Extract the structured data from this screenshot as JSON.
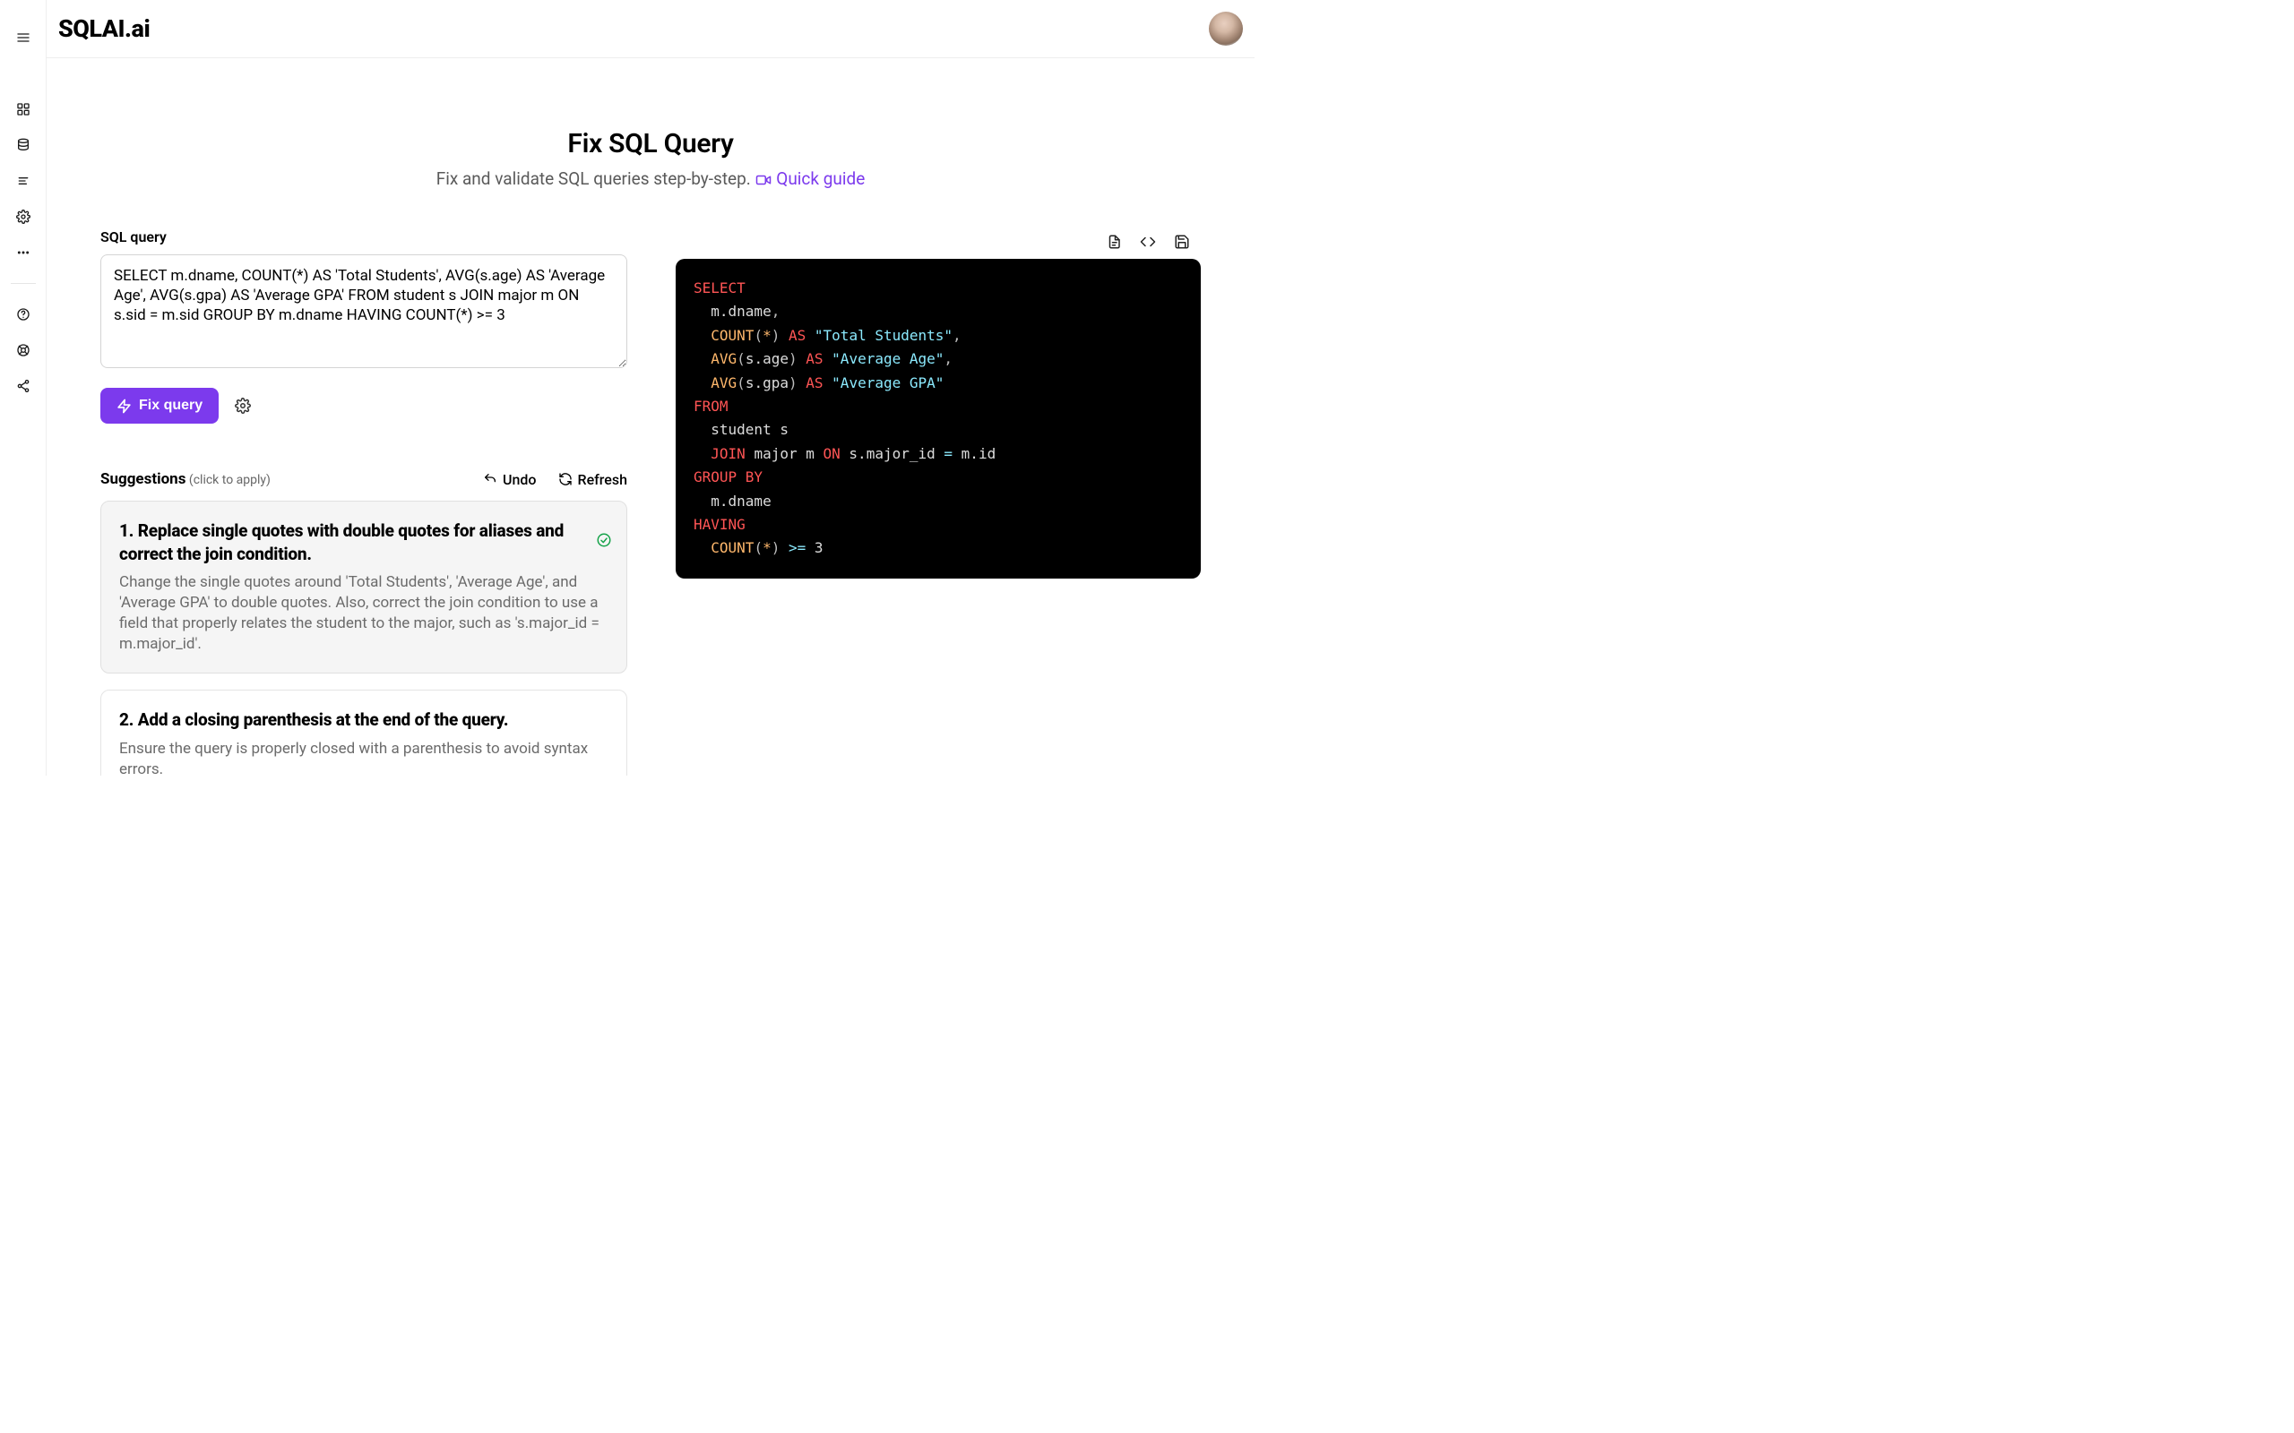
{
  "brand": "SQLAI.ai",
  "page": {
    "title": "Fix SQL Query",
    "subtitle": "Fix and validate SQL queries step-by-step.",
    "quick_guide": "Quick guide"
  },
  "input": {
    "label": "SQL query",
    "value": "SELECT m.dname, COUNT(*) AS 'Total Students', AVG(s.age) AS 'Average Age', AVG(s.gpa) AS 'Average GPA' FROM student s JOIN major m ON s.sid = m.sid GROUP BY m.dname HAVING COUNT(*) >= 3"
  },
  "actions": {
    "fix": "Fix query"
  },
  "suggestions": {
    "title": "Suggestions",
    "note": "(click to apply)",
    "undo": "Undo",
    "refresh": "Refresh",
    "items": [
      {
        "title": "1. Replace single quotes with double quotes for aliases and correct the join condition.",
        "body": "Change the single quotes around 'Total Students', 'Average Age', and 'Average GPA' to double quotes. Also, correct the join condition to use a field that properly relates the student to the major, such as 's.major_id = m.major_id'.",
        "applied": true
      },
      {
        "title": "2. Add a closing parenthesis at the end of the query.",
        "body": "Ensure the query is properly closed with a parenthesis to avoid syntax errors.",
        "applied": false
      }
    ]
  },
  "output": {
    "tokens": [
      {
        "t": "kw",
        "v": "SELECT"
      },
      {
        "t": "nl"
      },
      {
        "t": "sp",
        "v": "  "
      },
      {
        "t": "id",
        "v": "m.dname"
      },
      {
        "t": "punc",
        "v": ","
      },
      {
        "t": "nl"
      },
      {
        "t": "sp",
        "v": "  "
      },
      {
        "t": "func",
        "v": "COUNT"
      },
      {
        "t": "punc",
        "v": "("
      },
      {
        "t": "star",
        "v": "*"
      },
      {
        "t": "punc",
        "v": ")"
      },
      {
        "t": "sp",
        "v": " "
      },
      {
        "t": "alias-kw",
        "v": "AS"
      },
      {
        "t": "sp",
        "v": " "
      },
      {
        "t": "str",
        "v": "\"Total Students\""
      },
      {
        "t": "punc",
        "v": ","
      },
      {
        "t": "nl"
      },
      {
        "t": "sp",
        "v": "  "
      },
      {
        "t": "func",
        "v": "AVG"
      },
      {
        "t": "punc",
        "v": "("
      },
      {
        "t": "id",
        "v": "s.age"
      },
      {
        "t": "punc",
        "v": ")"
      },
      {
        "t": "sp",
        "v": " "
      },
      {
        "t": "alias-kw",
        "v": "AS"
      },
      {
        "t": "sp",
        "v": " "
      },
      {
        "t": "str",
        "v": "\"Average Age\""
      },
      {
        "t": "punc",
        "v": ","
      },
      {
        "t": "nl"
      },
      {
        "t": "sp",
        "v": "  "
      },
      {
        "t": "func",
        "v": "AVG"
      },
      {
        "t": "punc",
        "v": "("
      },
      {
        "t": "id",
        "v": "s.gpa"
      },
      {
        "t": "punc",
        "v": ")"
      },
      {
        "t": "sp",
        "v": " "
      },
      {
        "t": "alias-kw",
        "v": "AS"
      },
      {
        "t": "sp",
        "v": " "
      },
      {
        "t": "str",
        "v": "\"Average GPA\""
      },
      {
        "t": "nl"
      },
      {
        "t": "kw",
        "v": "FROM"
      },
      {
        "t": "nl"
      },
      {
        "t": "sp",
        "v": "  "
      },
      {
        "t": "id",
        "v": "student s"
      },
      {
        "t": "nl"
      },
      {
        "t": "sp",
        "v": "  "
      },
      {
        "t": "kw",
        "v": "JOIN"
      },
      {
        "t": "sp",
        "v": " "
      },
      {
        "t": "id",
        "v": "major m"
      },
      {
        "t": "sp",
        "v": " "
      },
      {
        "t": "kw",
        "v": "ON"
      },
      {
        "t": "sp",
        "v": " "
      },
      {
        "t": "id",
        "v": "s.major_id"
      },
      {
        "t": "sp",
        "v": " "
      },
      {
        "t": "op",
        "v": "="
      },
      {
        "t": "sp",
        "v": " "
      },
      {
        "t": "id",
        "v": "m.id"
      },
      {
        "t": "nl"
      },
      {
        "t": "kw",
        "v": "GROUP BY"
      },
      {
        "t": "nl"
      },
      {
        "t": "sp",
        "v": "  "
      },
      {
        "t": "id",
        "v": "m.dname"
      },
      {
        "t": "nl"
      },
      {
        "t": "kw",
        "v": "HAVING"
      },
      {
        "t": "nl"
      },
      {
        "t": "sp",
        "v": "  "
      },
      {
        "t": "func",
        "v": "COUNT"
      },
      {
        "t": "punc",
        "v": "("
      },
      {
        "t": "star",
        "v": "*"
      },
      {
        "t": "punc",
        "v": ")"
      },
      {
        "t": "sp",
        "v": " "
      },
      {
        "t": "op",
        "v": ">="
      },
      {
        "t": "sp",
        "v": " "
      },
      {
        "t": "num",
        "v": "3"
      }
    ]
  }
}
